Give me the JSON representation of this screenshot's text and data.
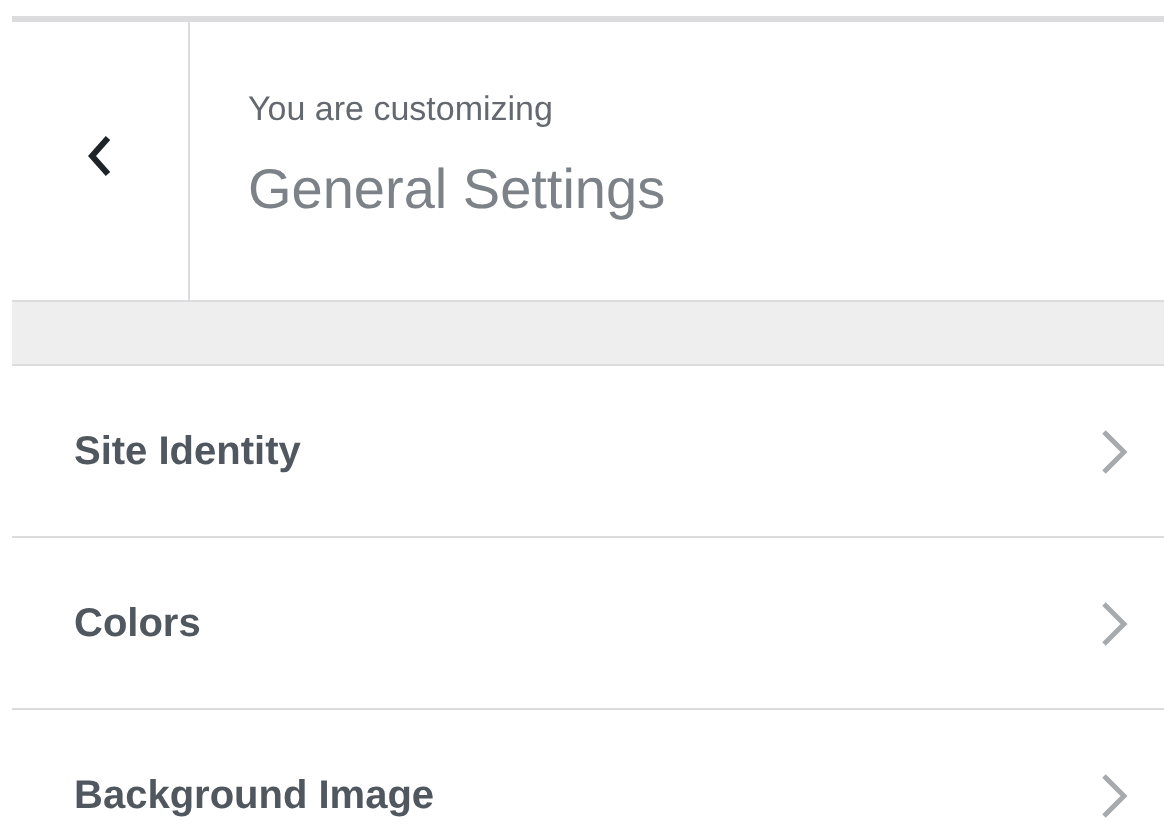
{
  "header": {
    "subtitle": "You are customizing",
    "title": "General Settings"
  },
  "sections": [
    {
      "label": "Site Identity"
    },
    {
      "label": "Colors"
    },
    {
      "label": "Background Image"
    }
  ]
}
